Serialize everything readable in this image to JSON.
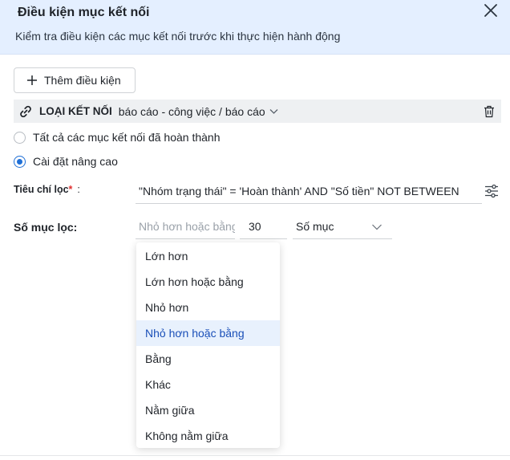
{
  "dialog": {
    "title": "Điều kiện mục kết nối",
    "subtitle": "Kiểm tra điều kiện các mục kết nối trước khi thực hiện hành động",
    "close_icon": "close-icon"
  },
  "add_condition": {
    "label": "Thêm điều kiện",
    "icon": "plus-icon"
  },
  "connection": {
    "type_label": "LOẠI KẾT NỐI",
    "type_value": "báo cáo - công việc / báo cáo",
    "icons": [
      "link-icon",
      "chevron-down-icon",
      "trash-icon"
    ]
  },
  "radios": [
    {
      "label": "Tất cả các mục kết nối đã hoàn thành",
      "checked": false
    },
    {
      "label": "Cài đặt nâng cao",
      "checked": true
    }
  ],
  "criteria": {
    "label": "Tiêu chí lọc",
    "required_mark": "*",
    "colon": ":",
    "value": "\"Nhóm trạng thái\" = 'Hoàn thành' AND \"Số tiền\" NOT BETWEEN",
    "icon": "sliders-icon"
  },
  "item_count": {
    "label": "Số mục lọc:",
    "operator_placeholder": "Nhỏ hơn hoặc bằng",
    "number_value": "30",
    "unit_value": "Số mục"
  },
  "operator_options": [
    "Lớn hơn",
    "Lớn hơn hoặc bằng",
    "Nhỏ hơn",
    "Nhỏ hơn hoặc bằng",
    "Bằng",
    "Khác",
    "Nằm giữa",
    "Không nằm giữa"
  ],
  "highlighted_option": "Nhỏ hơn hoặc bằng",
  "colors": {
    "header_bg": "#e4efff",
    "accent": "#1f6fd6",
    "highlight_bg": "#e8f1fd",
    "required": "#e03131"
  }
}
